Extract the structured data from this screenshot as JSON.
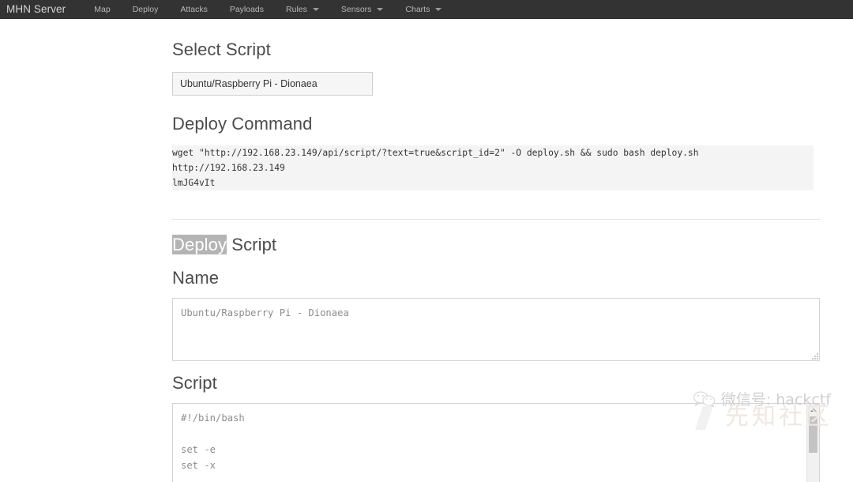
{
  "navbar": {
    "brand": "MHN Server",
    "items": [
      {
        "label": "Map",
        "caret": false,
        "icon": ""
      },
      {
        "label": "Deploy",
        "caret": false,
        "icon": ""
      },
      {
        "label": "Attacks",
        "caret": false,
        "icon": ""
      },
      {
        "label": "Payloads",
        "caret": false,
        "icon": ""
      },
      {
        "label": "Rules",
        "caret": true,
        "icon": "chevron-down-icon"
      },
      {
        "label": "Sensors",
        "caret": true,
        "icon": "chevron-down-icon"
      },
      {
        "label": "Charts",
        "caret": true,
        "icon": "chevron-down-icon"
      }
    ]
  },
  "select_script": {
    "heading": "Select Script",
    "selected": "Ubuntu/Raspberry Pi - Dionaea"
  },
  "deploy_command": {
    "heading": "Deploy Command",
    "line1": "wget \"http://192.168.23.149/api/script/?text=true&script_id=2\" -O deploy.sh && sudo bash deploy.sh http://192.168.23.149",
    "line2": "lmJG4vIt"
  },
  "deploy_script": {
    "heading_selected": "Deploy",
    "heading_rest": " Script",
    "name_label": "Name",
    "name_value": "Ubuntu/Raspberry Pi - Dionaea",
    "script_label": "Script",
    "script_value": "#!/bin/bash\n\nset -e\nset -x"
  },
  "watermark": {
    "wechat_text": "微信号: hackctf",
    "site_text": "先知社区",
    "icon": "wechat-icon"
  },
  "colors": {
    "navbar_bg": "#333333",
    "page_bg": "#ffffff",
    "heading": "#4c4c4c",
    "code_bg": "#f4f4f4",
    "selection": "#b4b4b4"
  }
}
